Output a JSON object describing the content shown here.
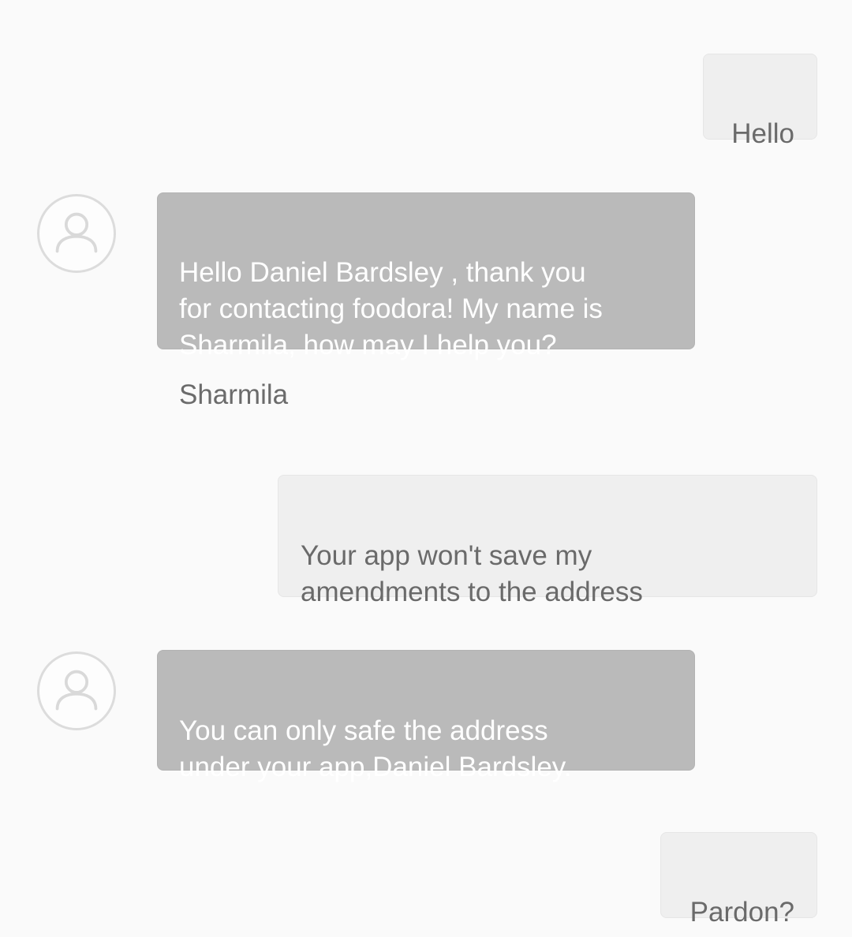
{
  "agent": {
    "name": "Sharmila"
  },
  "messages": [
    {
      "from": "user",
      "text": "Hello"
    },
    {
      "from": "agent",
      "text": "Hello Daniel  Bardsley  , thank you\nfor contacting foodora! My name is\nSharmila, how may I help you?"
    },
    {
      "from": "user",
      "text": "Your app won't save my\namendments to the address"
    },
    {
      "from": "agent",
      "text": "You can only safe the address\nunder your app,Daniel Bardsley."
    },
    {
      "from": "user",
      "text": "Pardon?"
    }
  ],
  "icons": {
    "avatar": "user-avatar-icon"
  },
  "colors": {
    "background": "#fafafa",
    "user_bubble": "#efefef",
    "agent_bubble": "#bababa",
    "user_text": "#6a6a6a",
    "agent_text": "#ffffff"
  }
}
